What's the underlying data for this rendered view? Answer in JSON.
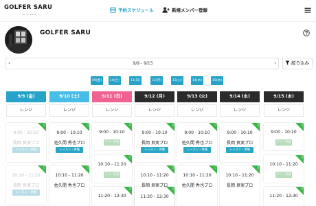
{
  "header": {
    "logo": "GOLFER SARU",
    "logo_sub": "since 2020",
    "nav_schedule": "予約スケジュール",
    "nav_register": "新規メンバー登録"
  },
  "profile": {
    "name": "GOLFER SARU"
  },
  "week": {
    "range": "9/9 - 9/15",
    "prev": "‹",
    "next": "›",
    "filter_label": "絞り込み"
  },
  "day_chips": [
    "09(金)",
    "10(土)",
    "11(日)",
    "12(月)",
    "13(火)",
    "14(水)",
    "15(木)"
  ],
  "days": [
    {
      "label": "9/9 (金)",
      "color": "#27a3c9",
      "sub": "レンジ"
    },
    {
      "label": "9/10 (土)",
      "color": "#47bde8",
      "sub": "レンジ"
    },
    {
      "label": "9/11 (日)",
      "color": "#f06292",
      "sub": "レンジ"
    },
    {
      "label": "9/12 (月)",
      "color": "#2b2b2b",
      "sub": "レンジ"
    },
    {
      "label": "9/13 (火)",
      "color": "#2b2b2b",
      "sub": "レンジ"
    },
    {
      "label": "9/14 (水)",
      "color": "#2b2b2b",
      "sub": "レンジ"
    },
    {
      "label": "9/15 (木)",
      "color": "#2b2b2b",
      "sub": "レンジ"
    }
  ],
  "colors": {
    "accent": "#27a3c9",
    "lesson_tag": "#2aa7c6",
    "corner_green": "#3bb54a"
  },
  "cards": [
    {
      "time": "9:00 - 10:10",
      "coach": "長岡 良実プロ",
      "tag": "レッスン・体験"
    },
    {
      "time": "10:10 - 11:20",
      "coach": "長岡 良実プロ",
      "tag": "レッスン・体験"
    },
    {
      "time": "9:00 - 10:10",
      "coach": "佐久間 秀也プロ",
      "tag": "レッスン・体験"
    },
    {
      "time": "10:10 - 11:20",
      "coach": "佐久間 秀也プロ",
      "tag": ""
    },
    {
      "time": "9:00 - 10:10",
      "coach": "",
      "tag": "フリー打席"
    },
    {
      "time": "10:10 - 11:20",
      "coach": "",
      "tag": "フリー打席"
    },
    {
      "time": "11:20 - 12:30",
      "coach": "",
      "tag": ""
    },
    {
      "time": "9:00 - 10:10",
      "coach": "長岡 良実プロ",
      "tag": "レッスン・体験"
    },
    {
      "time": "10:10 - 11:20",
      "coach": "長岡 良実プロ",
      "tag": ""
    },
    {
      "time": "11:20 - 12:30",
      "coach": "",
      "tag": ""
    },
    {
      "time": "9:00 - 10:10",
      "coach": "佐久間 秀也プロ",
      "tag": "レッスン・体験"
    },
    {
      "time": "10:10 - 11:20",
      "coach": "佐久間 秀也プロ",
      "tag": ""
    },
    {
      "time": "9:00 - 10:10",
      "coach": "長岡 良実プロ",
      "tag": "レッスン・体験"
    },
    {
      "time": "10:10 - 11:20",
      "coach": "長岡 良実プロ",
      "tag": ""
    },
    {
      "time": "9:00 - 10:10",
      "coach": "",
      "tag": "フリー打席"
    },
    {
      "time": "10:10 - 11:20",
      "coach": "",
      "tag": "フリー打席"
    },
    {
      "time": "11:20 - 12:30",
      "coach": "",
      "tag": ""
    }
  ]
}
